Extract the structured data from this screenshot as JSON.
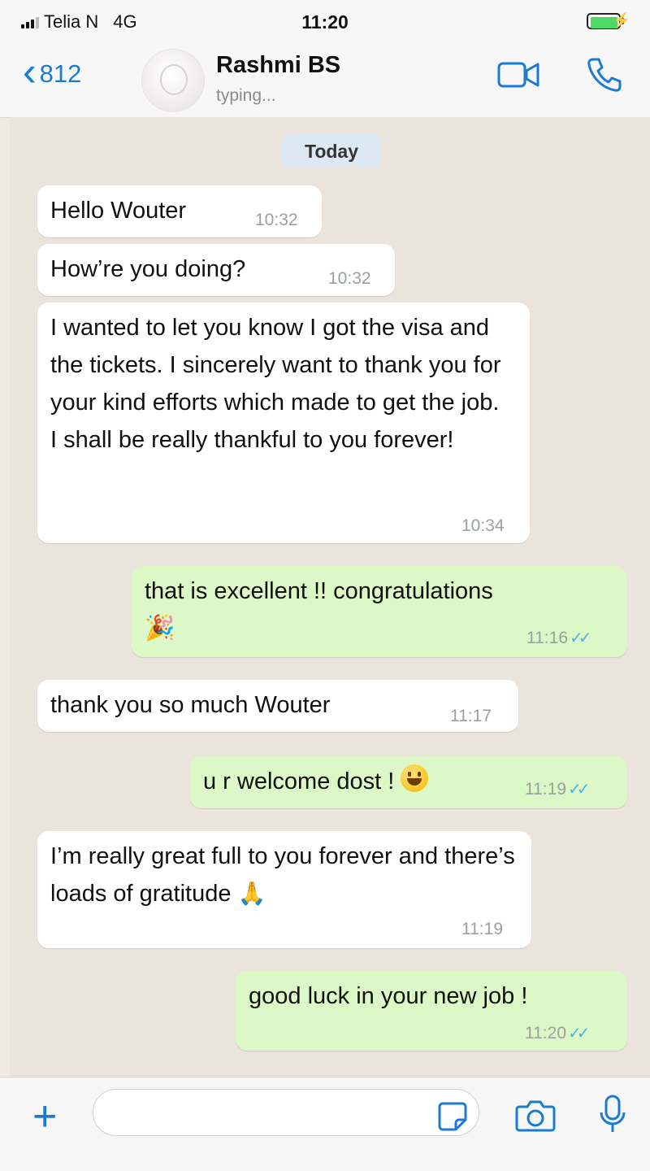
{
  "status_bar": {
    "carrier": "Telia N",
    "network": "4G",
    "time": "11:20",
    "bolt": "⚡"
  },
  "header": {
    "back_count": "812",
    "back_chevron": "‹",
    "contact_name": "Rashmi BS",
    "contact_status": "typing...",
    "icons": [
      "video-call-icon",
      "phone-icon"
    ]
  },
  "chat": {
    "date_label": "Today",
    "messages": [
      {
        "direction": "incoming",
        "text": "Hello Wouter",
        "time": "10:32"
      },
      {
        "direction": "incoming",
        "text": "How’re you doing?",
        "time": "10:32"
      },
      {
        "direction": "incoming",
        "text": "I wanted to let you know I got the visa and the tickets. I sincerely want to thank you for your kind efforts which made to get the job. I shall be really thankful to you forever!",
        "time": "10:34"
      },
      {
        "direction": "outgoing",
        "text": "that is excellent !! congratulations",
        "emoji": "🎉",
        "time": "11:16",
        "read": true
      },
      {
        "direction": "incoming",
        "text": "thank you so much Wouter",
        "time": "11:17"
      },
      {
        "direction": "outgoing",
        "text": "u r welcome dost !",
        "emoji": "grinning-face",
        "time": "11:19",
        "read": true
      },
      {
        "direction": "incoming",
        "text": "I’m really great full to you forever and there’s loads of gratitude",
        "emoji": "🙏",
        "time": "11:19"
      },
      {
        "direction": "outgoing",
        "text": "good luck in your new job !",
        "time": "11:20",
        "read": true
      }
    ],
    "read_ticks": "✓✓"
  },
  "input_bar": {
    "plus": "+",
    "message_value": "",
    "icons": [
      "sticker-icon",
      "camera-icon",
      "microphone-icon"
    ]
  },
  "colors": {
    "accent": "#1a7bd1",
    "incoming_bubble": "#ffffff",
    "outgoing_bubble": "#dcf8c6",
    "chat_background": "#ebe4dc",
    "read_tick": "#4fb3ea"
  }
}
